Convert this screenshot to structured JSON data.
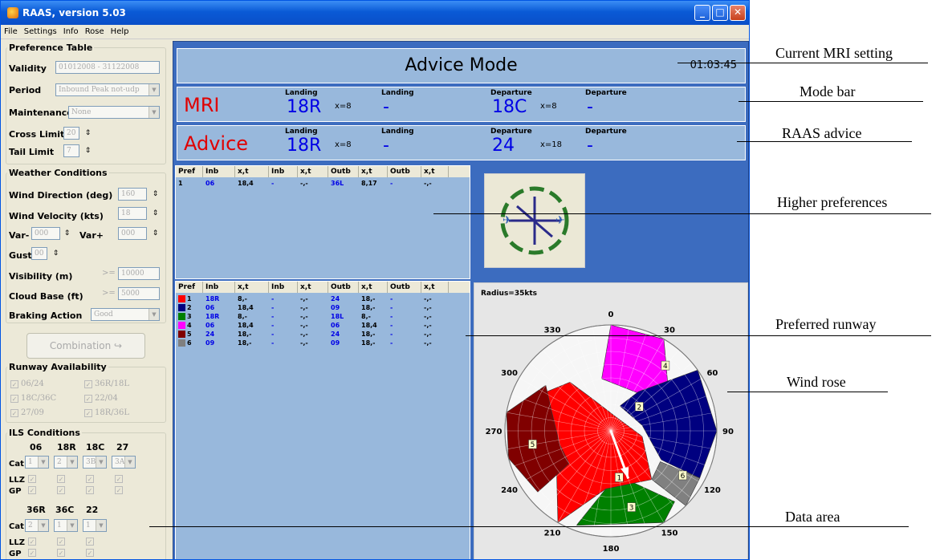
{
  "window": {
    "title": "RAAS, version 5.03"
  },
  "menu": [
    "File",
    "Settings",
    "Info",
    "Rose",
    "Help"
  ],
  "preference": {
    "group": "Preference Table",
    "validity_label": "Validity",
    "validity_value": "01012008 - 31122008",
    "period_label": "Period",
    "period_value": "Inbound Peak not-udp",
    "maintenance_label": "Maintenance",
    "maintenance_value": "None",
    "cross_label": "Cross Limit",
    "cross_value": "20",
    "tail_label": "Tail Limit",
    "tail_value": "7"
  },
  "weather": {
    "group": "Weather Conditions",
    "wind_dir_label": "Wind Direction (deg)",
    "wind_dir_value": "160",
    "wind_vel_label": "Wind Velocity (kts)",
    "wind_vel_value": "18",
    "var_minus_label": "Var-",
    "var_minus_value": "000",
    "var_plus_label": "Var+",
    "var_plus_value": "000",
    "gust_label": "Gust",
    "gust_value": "00",
    "visibility_label": "Visibility (m)",
    "visibility_op": ">=",
    "visibility_value": "10000",
    "cloud_label": "Cloud Base (ft)",
    "cloud_op": ">=",
    "cloud_value": "5000",
    "braking_label": "Braking Action",
    "braking_value": "Good"
  },
  "combination_label": "Combination",
  "runway_availability": {
    "group": "Runway Availability",
    "items": [
      "06/24",
      "36R/18L",
      "18C/36C",
      "22/04",
      "27/09",
      "18R/36L"
    ]
  },
  "ils": {
    "group": "ILS Conditions",
    "cols1": [
      "06",
      "18R",
      "18C",
      "27"
    ],
    "cat1": [
      "1",
      "2",
      "3B",
      "3A"
    ],
    "cols2": [
      "36R",
      "36C",
      "22"
    ],
    "cat2": [
      "2",
      "1",
      "1"
    ],
    "cat_label": "Cat",
    "llz_label": "LLZ",
    "gp_label": "GP"
  },
  "mode": {
    "title": "Advice Mode",
    "time": "01:03:45"
  },
  "mri": {
    "label": "MRI",
    "land1_label": "Landing",
    "land1_rwy": "18R",
    "land1_x": "x=8",
    "land2_label": "Landing",
    "land2_rwy": "-",
    "dep1_label": "Departure",
    "dep1_rwy": "18C",
    "dep1_x": "x=8",
    "dep2_label": "Departure",
    "dep2_rwy": "-"
  },
  "advice": {
    "label": "Advice",
    "land1_label": "Landing",
    "land1_rwy": "18R",
    "land1_x": "x=8",
    "land2_label": "Landing",
    "land2_rwy": "-",
    "dep1_label": "Departure",
    "dep1_rwy": "24",
    "dep1_x": "x=18",
    "dep2_label": "Departure",
    "dep2_rwy": "-"
  },
  "table_headers": [
    "Pref",
    "Inb",
    "x,t",
    "Inb",
    "x,t",
    "Outb",
    "x,t",
    "Outb",
    "x,t"
  ],
  "higher_rows": [
    [
      "1",
      "06",
      "18,4",
      "-",
      "-,-",
      "36L",
      "8,17",
      "-",
      "-,-"
    ]
  ],
  "preferred_rows": [
    [
      "1",
      "18R",
      "8,-",
      "-",
      "-,-",
      "24",
      "18,-",
      "-",
      "-,-"
    ],
    [
      "2",
      "06",
      "18,4",
      "-",
      "-,-",
      "09",
      "18,-",
      "-",
      "-,-"
    ],
    [
      "3",
      "18R",
      "8,-",
      "-",
      "-,-",
      "18L",
      "8,-",
      "-",
      "-,-"
    ],
    [
      "4",
      "06",
      "18,4",
      "-",
      "-,-",
      "06",
      "18,4",
      "-",
      "-,-"
    ],
    [
      "5",
      "24",
      "18,-",
      "-",
      "-,-",
      "24",
      "18,-",
      "-",
      "-,-"
    ],
    [
      "6",
      "09",
      "18,-",
      "-",
      "-,-",
      "09",
      "18,-",
      "-",
      "-,-"
    ]
  ],
  "pref_colors": [
    "#ff0000",
    "#000080",
    "#008000",
    "#ff00ff",
    "#800000",
    "#808080"
  ],
  "rose": {
    "radius_label": "Radius=35kts",
    "angles": [
      "0",
      "30",
      "60",
      "90",
      "120",
      "150",
      "180",
      "210",
      "240",
      "270",
      "300",
      "330"
    ],
    "sector_labels": [
      "1",
      "2",
      "3",
      "4",
      "5",
      "6"
    ]
  },
  "logo_text": [
    "R",
    "A",
    "A",
    "S",
    "R",
    "A",
    "A",
    "S"
  ],
  "annotations": [
    "Current MRI setting",
    "Mode bar",
    "RAAS advice",
    "Higher preferences",
    "Preferred runway",
    "Wind rose",
    "Data area"
  ]
}
